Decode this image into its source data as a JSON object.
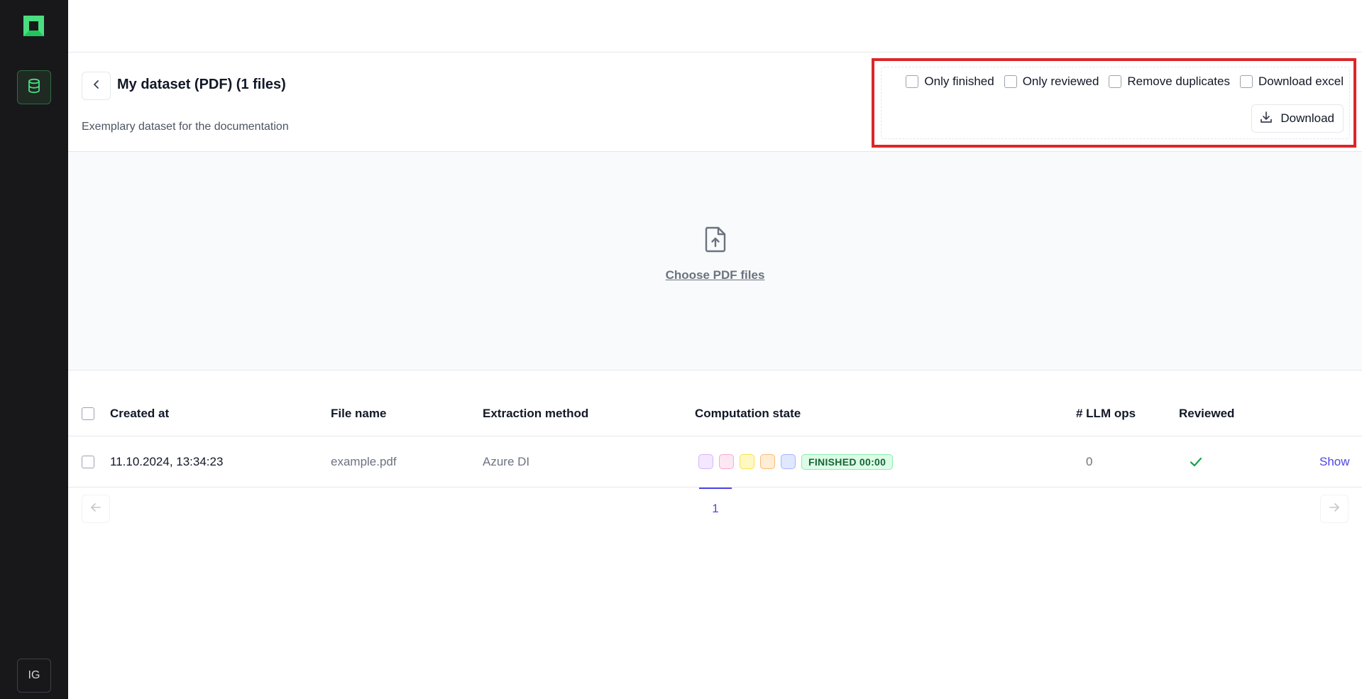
{
  "sidebar": {
    "avatar_initials": "IG",
    "accent": "#4ade80",
    "icons": [
      "app-logo-icon",
      "database-icon"
    ]
  },
  "dataset": {
    "title": "My dataset (PDF) (1 files)",
    "description": "Exemplary dataset for the documentation"
  },
  "export": {
    "options": [
      {
        "label": "Only finished",
        "checked": false
      },
      {
        "label": "Only reviewed",
        "checked": false
      },
      {
        "label": "Remove duplicates",
        "checked": false
      },
      {
        "label": "Download excel",
        "checked": false
      }
    ],
    "download_label": "Download"
  },
  "upload": {
    "choose_label": "Choose PDF files"
  },
  "table": {
    "headers": {
      "created_at": "Created at",
      "file_name": "File name",
      "extraction_method": "Extraction method",
      "computation_state": "Computation state",
      "llm_ops": "# LLM ops",
      "reviewed": "Reviewed"
    },
    "rows": [
      {
        "created_at": "11.10.2024, 13:34:23",
        "file_name": "example.pdf",
        "extraction_method": "Azure DI",
        "state_chips": [
          "#f3e8ff",
          "#fce7f3",
          "#fef9c3",
          "#ffedd5",
          "#e0e7ff"
        ],
        "state_badge": "FINISHED 00:00",
        "llm_ops": "0",
        "reviewed": true,
        "action": "Show"
      }
    ]
  },
  "pagination": {
    "current_page": "1"
  },
  "colors": {
    "accent_link": "#4f46e5",
    "success": "#16a34a",
    "highlight_box": "#dc2626"
  }
}
